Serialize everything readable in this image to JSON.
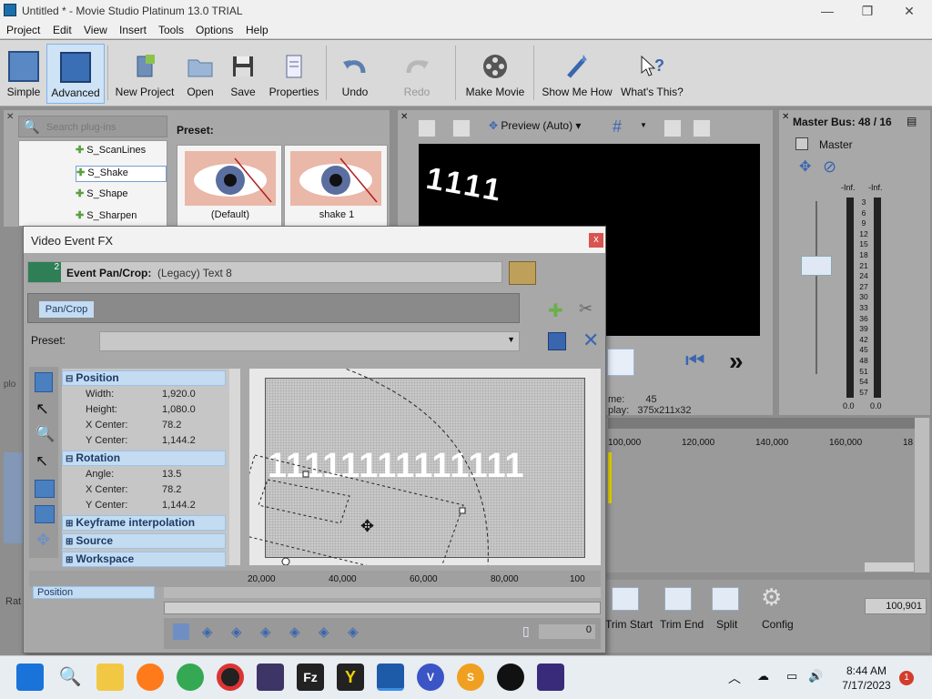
{
  "window": {
    "title": "Untitled * - Movie Studio Platinum 13.0 TRIAL",
    "min": "—",
    "max": "❐",
    "close": "✕"
  },
  "menu": [
    "Project",
    "Edit",
    "View",
    "Insert",
    "Tools",
    "Options",
    "Help"
  ],
  "toolbar": {
    "simple": "Simple",
    "advanced": "Advanced",
    "new_project": "New Project",
    "open": "Open",
    "save": "Save",
    "properties": "Properties",
    "undo": "Undo",
    "redo": "Redo",
    "make_movie": "Make Movie",
    "show_me_how": "Show Me How",
    "whats_this": "What's This?"
  },
  "plugins": {
    "search_placeholder": "Search plug-ins",
    "items": [
      "S_ScanLines",
      "S_Shake",
      "S_Shape",
      "S_Sharpen"
    ],
    "preset_label": "Preset:",
    "presets": [
      "(Default)",
      "shake 1"
    ]
  },
  "preview": {
    "mode": "Preview (Auto)",
    "overlay_text": "1111",
    "frame_label": "me:",
    "frame_value": "45",
    "display_label": "play:",
    "display_value": "375x211x32"
  },
  "master": {
    "title": "Master Bus: 48 / 16",
    "bus_name": "Master",
    "left_peak": "-Inf.",
    "right_peak": "-Inf.",
    "scale": [
      "3",
      "6",
      "9",
      "12",
      "15",
      "18",
      "21",
      "24",
      "27",
      "30",
      "33",
      "36",
      "39",
      "42",
      "45",
      "48",
      "51",
      "54",
      "57"
    ],
    "left_bottom": "0.0",
    "right_bottom": "0.0"
  },
  "timeline": {
    "ruler": [
      "100,000",
      "120,000",
      "140,000",
      "160,000",
      "18"
    ]
  },
  "edit_tools": {
    "trim_start": "Trim Start",
    "trim_end": "Trim End",
    "split": "Split",
    "config": "Config",
    "counter": "100,901"
  },
  "dialog": {
    "title": "Video Event FX",
    "close": "x",
    "chain_num": "2",
    "event_label": "Event Pan/Crop:",
    "event_name": "(Legacy) Text 8",
    "chain_item": "Pan/Crop",
    "preset_label": "Preset:",
    "sections": {
      "position": "Position",
      "rotation": "Rotation",
      "keyframe": "Keyframe interpolation",
      "source": "Source",
      "workspace": "Workspace"
    },
    "position_rows": [
      {
        "label": "Width:",
        "value": "1,920.0"
      },
      {
        "label": "Height:",
        "value": "1,080.0"
      },
      {
        "label": "X Center:",
        "value": "78.2"
      },
      {
        "label": "Y Center:",
        "value": "1,144.2"
      }
    ],
    "rotation_rows": [
      {
        "label": "Angle:",
        "value": "13.5"
      },
      {
        "label": "X Center:",
        "value": "78.2"
      },
      {
        "label": "Y Center:",
        "value": "1,144.2"
      }
    ],
    "canvas_text": "11111111111111",
    "keyframe_track": "Position",
    "ruler": [
      "20,000",
      "40,000",
      "60,000",
      "80,000",
      "100"
    ],
    "counter": "0"
  },
  "left_labels": {
    "plo": "plo",
    "rat": "Rat"
  },
  "taskbar": {
    "time": "8:44 AM",
    "date": "7/17/2023",
    "notif": "1"
  }
}
